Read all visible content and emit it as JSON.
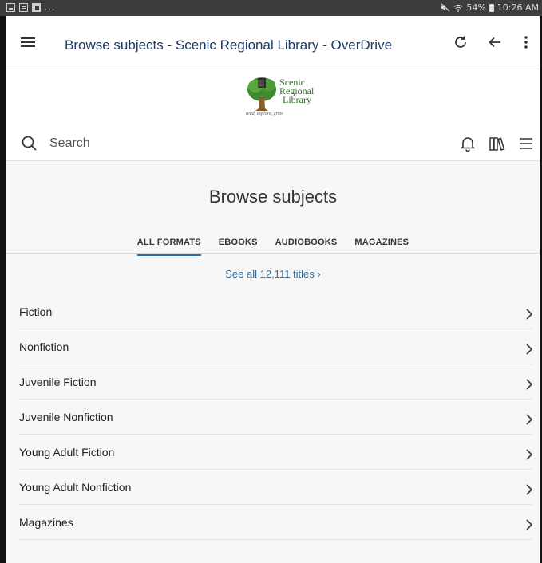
{
  "status_bar": {
    "dots": "...",
    "battery": "54%",
    "time": "10:26 AM"
  },
  "browser": {
    "title": "Browse subjects - Scenic Regional Library - OverDrive"
  },
  "library": {
    "logo_line1": "Scenic",
    "logo_line2": "Regional",
    "logo_line3": "Library",
    "logo_tagline": "read, explore, grow"
  },
  "search": {
    "placeholder": "Search"
  },
  "page": {
    "title": "Browse subjects",
    "tabs": [
      {
        "label": "ALL FORMATS"
      },
      {
        "label": "EBOOKS"
      },
      {
        "label": "AUDIOBOOKS"
      },
      {
        "label": "MAGAZINES"
      }
    ],
    "see_all": "See all 12,111 titles ›",
    "subjects": [
      {
        "label": "Fiction"
      },
      {
        "label": "Nonfiction"
      },
      {
        "label": "Juvenile Fiction"
      },
      {
        "label": "Juvenile Nonfiction"
      },
      {
        "label": "Young Adult Fiction"
      },
      {
        "label": "Young Adult Nonfiction"
      },
      {
        "label": "Magazines"
      }
    ]
  },
  "colors": {
    "accent": "#2b6ea3",
    "title_blue": "#1c3a6b",
    "logo_green": "#2f6b26"
  }
}
